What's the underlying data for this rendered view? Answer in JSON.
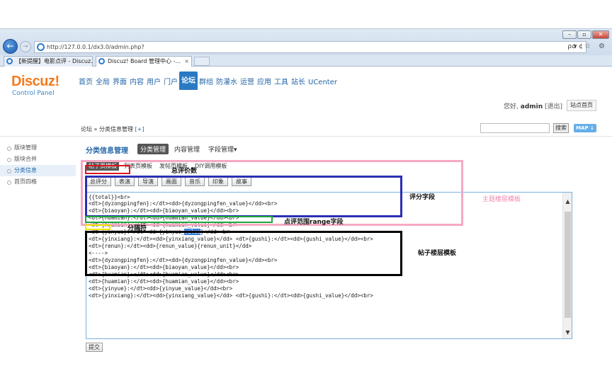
{
  "browser": {
    "window_buttons": [
      "–",
      "▫",
      "✕"
    ],
    "url": "http://127.0.0.1/dx3.0/admin.php?",
    "url_tools": "ρ ▾ ¢",
    "nav_icons": "⌂ ☆ ⚙",
    "tabs": [
      {
        "label": "【新提醒】电影点评 - Discuz..."
      },
      {
        "label": "Discuz! Board 管理中心 -...",
        "close": "×"
      }
    ]
  },
  "header": {
    "logo": "Discuz!",
    "logo_sub": "Control Panel",
    "nav": [
      "首页",
      "全局",
      "界面",
      "内容",
      "用户",
      "门户",
      "论坛",
      "群组",
      "防灌水",
      "运营",
      "应用",
      "工具",
      "站长",
      "UCenter"
    ],
    "active_nav": "论坛",
    "user_greeting": "您好,",
    "username": "admin",
    "logout": "[退出]",
    "home_button": "站点首页"
  },
  "breadcrumb": {
    "path": "论坛 » 分类信息管理",
    "add": "[+]",
    "search_button": "搜索",
    "map_button": "MAP ↓"
  },
  "sidebar": {
    "items": [
      "版块管理",
      "版块合并",
      "分类信息",
      "首页四格"
    ],
    "active_index": 2
  },
  "section": {
    "title": "分类信息管理",
    "tabs": [
      "分类管理",
      "内容管理",
      "字段管理▾"
    ],
    "active_tab": 0
  },
  "template_tabs": {
    "items": [
      "帖子页模板",
      "列表页模板",
      "发帖页模板",
      "DIY调用模板"
    ],
    "active_index": 0
  },
  "tool_buttons": [
    "总评分",
    "表演",
    "导演",
    "画面",
    "音乐",
    "印象",
    "故事"
  ],
  "editor": {
    "lines": [
      "{{total}}<br>",
      "<dt>{dyzongpingfen}:</dt><dd>{dyzongpingfen_value}</dd><br>",
      "<dt>{biaoyan}:</dt><dd>{biaoyan_value}</dd><br>",
      "<dt>{huamian}:</dt><dd>{huamian_value}</dd><br>",
      "<dt>{huamian}:</dt><dd>{huamian_value}</dd><br>",
      "<dt>{yinyue}:</dt><dd>{yinyue_value}</dd><br>",
      "<dt>{yinxiang}:</dt><dd>{yinxiang_value}</dd> <dt>{gushi}:</dt><dd>{gushi_value}</dd><br>",
      "<dt>{renun}:</dt><dd>{renun_value}{renun_unit}</dd>",
      "<---->",
      "<dt>{dyzongpingfen}:</dt><dd>{dyzongpingfen_value}</dd><br>",
      "<dt>{biaoyan}:</dt><dd>{biaoyan_value}</dd><br>",
      "<dt>{huamian}:</dt><dd>{huamian_value}</dd><br>",
      "<dt>{huamian}:</dt><dd>{huamian_value}</dd><br>",
      "<dt>{yinyue}:</dt><dd>{yinyue_value}</dd><br>",
      "<dt>{yinxiang}:</dt><dd>{yinxiang_value}</dd> <dt>{gushi}:</dt><dd>{gushi_value}</dd><br>"
    ],
    "yinyue_prefix": "<dt>{yinyue}:</dt><dd>{yinyue_",
    "yinyue_selected": "value",
    "yinyue_suffix": "}</dd><br>",
    "scroll_up": "▲",
    "scroll_down": "▼"
  },
  "submit_button": "提交",
  "annotations": {
    "total": "总评价数",
    "fields": "评分字段",
    "main_template": "主题楼层模板",
    "range": "点评范围range字段",
    "separator": "分隔符",
    "reply_template": "帖子楼层模板"
  },
  "colors": {
    "accent": "#2a79c3",
    "red_box": "#e0141f",
    "blue_box": "#2b2fb3",
    "pink_box": "#f6a9c3",
    "green_box": "#1ea83a",
    "yellow_box": "#f2e600",
    "black_box": "#000000",
    "pink_text": "#f08ab0"
  }
}
